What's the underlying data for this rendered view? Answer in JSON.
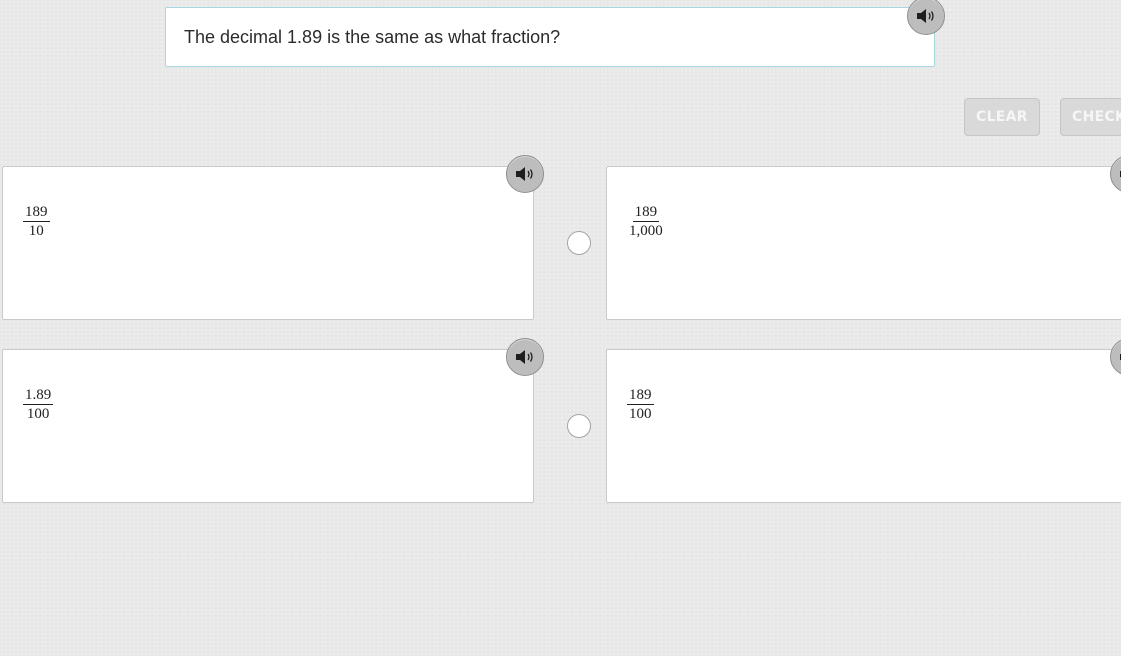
{
  "question": {
    "text": "The decimal 1.89 is the same as what fraction?",
    "audio_icon": "speaker-icon"
  },
  "toolbar": {
    "clear_label": "CLEAR",
    "check_label": "CHECK"
  },
  "answers": [
    {
      "numerator": "189",
      "denominator": "10",
      "selected": false
    },
    {
      "numerator": "189",
      "denominator": "1,000",
      "selected": false
    },
    {
      "numerator": "1.89",
      "denominator": "100",
      "selected": false
    },
    {
      "numerator": "189",
      "denominator": "100",
      "selected": false
    }
  ],
  "colors": {
    "background": "#e8e8e8",
    "card": "#ffffff",
    "question_border": "#a9d6e0",
    "button_disabled": "#d9d9d9",
    "audio_button": "#bdbdbd"
  }
}
